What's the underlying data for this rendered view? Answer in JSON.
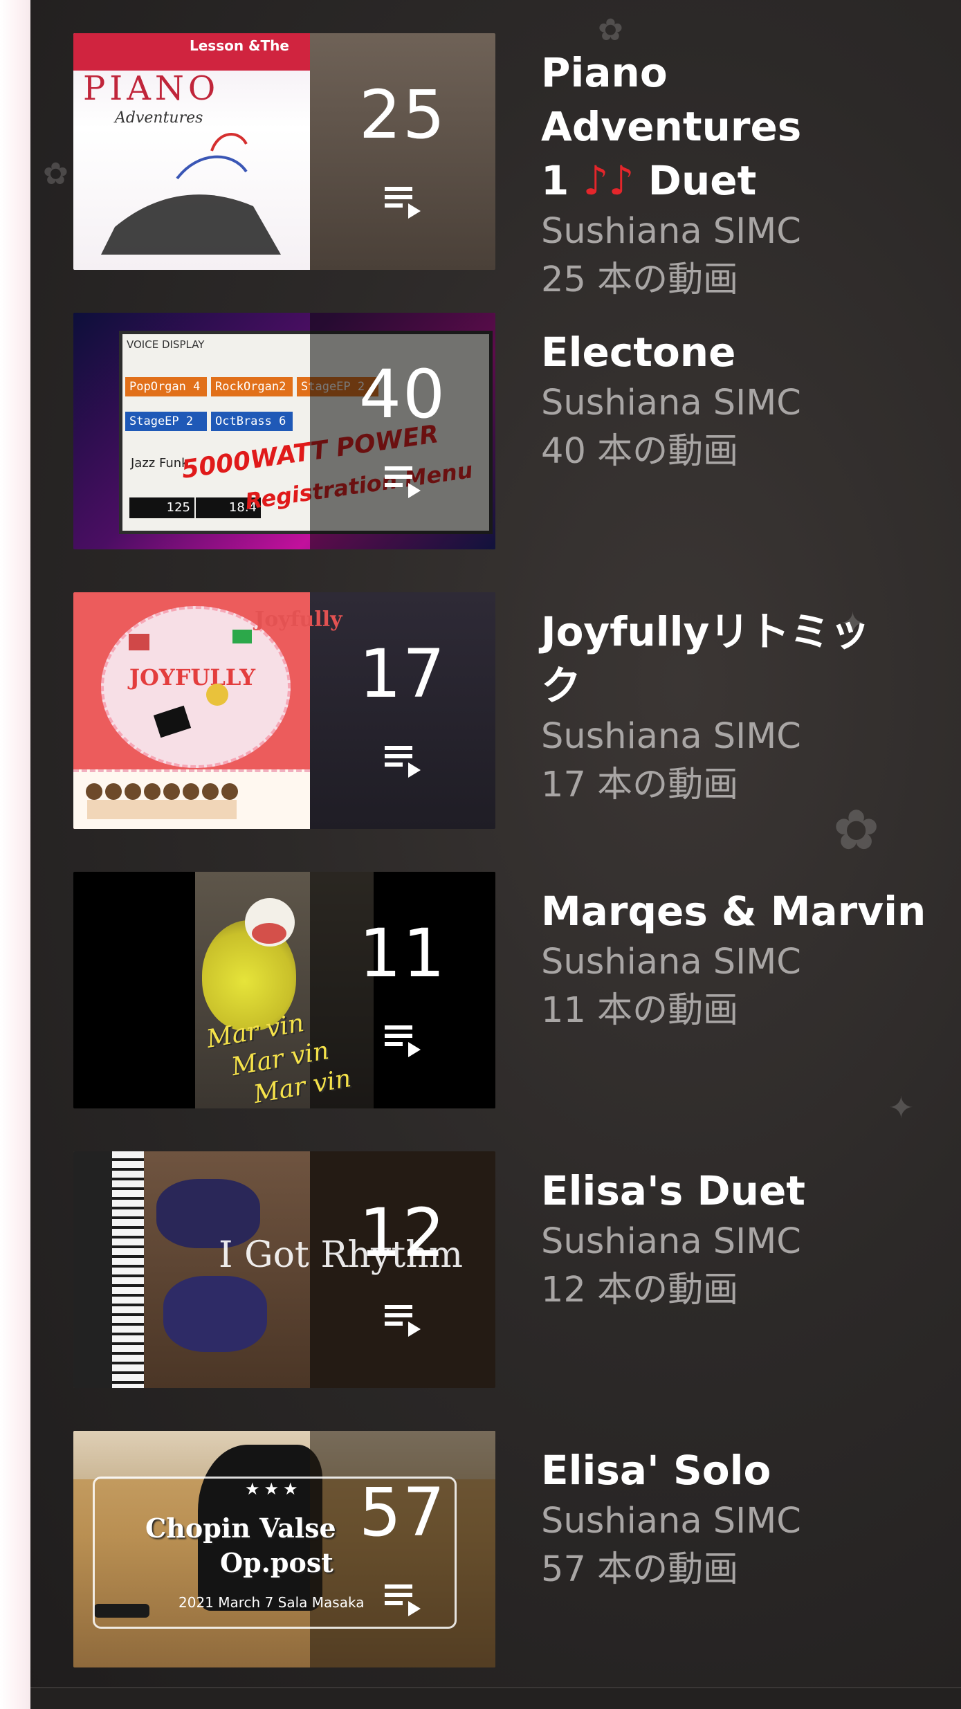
{
  "playlists": [
    {
      "title_text": "Piano Adventures",
      "title_line2_prefix": "1",
      "title_line2_notes": "♪♪",
      "title_line2_suffix": "Duet",
      "channel": "Sushiana SIMC",
      "videos": "25 本の動画",
      "count": "25",
      "thumb_lesson": "Lesson &The",
      "thumb_word": "PIANO",
      "thumb_sub": "Adventures"
    },
    {
      "title_text": "Electone",
      "channel": "Sushiana SIMC",
      "videos": "40 本の動画",
      "count": "40",
      "thumb_header": "VOICE DISPLAY",
      "thumb_voice1": "PopOrgan 4",
      "thumb_voice2": "RockOrgan2",
      "thumb_voice3": "StageEP 2",
      "thumb_voice4": "StageEP 2",
      "thumb_voice5": "OctBrass 6",
      "thumb_style": "Jazz Funk",
      "thumb_tempo": "125",
      "thumb_bar": "18.4",
      "thumb_banner1": "5000WATT POWER",
      "thumb_banner2": "Registration Menu"
    },
    {
      "title_text": "Joyfullyリトミッ",
      "title_line2": "ク",
      "channel": "Sushiana SIMC",
      "videos": "17 本の動画",
      "count": "17",
      "thumb_word": "JOYFULLY",
      "thumb_right": "Joyfully"
    },
    {
      "title_text": "Marqes & Marvin",
      "channel": "Sushiana SIMC",
      "videos": "11 本の動画",
      "count": "11",
      "thumb_word1": "Mar vin",
      "thumb_word2": "Mar vin",
      "thumb_word3": "Mar vin"
    },
    {
      "title_text": "Elisa's Duet",
      "channel": "Sushiana SIMC",
      "videos": "12 本の動画",
      "count": "12",
      "thumb_word": "I Got Rhythm"
    },
    {
      "title_text": "Elisa' Solo",
      "channel": "Sushiana SIMC",
      "videos": "57 本の動画",
      "count": "57",
      "thumb_title1": "Chopin Valse",
      "thumb_title2": "Op.post",
      "thumb_date": "2021 March 7 Sala Masaka"
    }
  ],
  "icons": {
    "playlist": "playlist-play-icon"
  },
  "colors": {
    "background": "#2c2928",
    "title": "#ffffff",
    "meta": "#a9a6a5",
    "notes": "#e4262b"
  }
}
